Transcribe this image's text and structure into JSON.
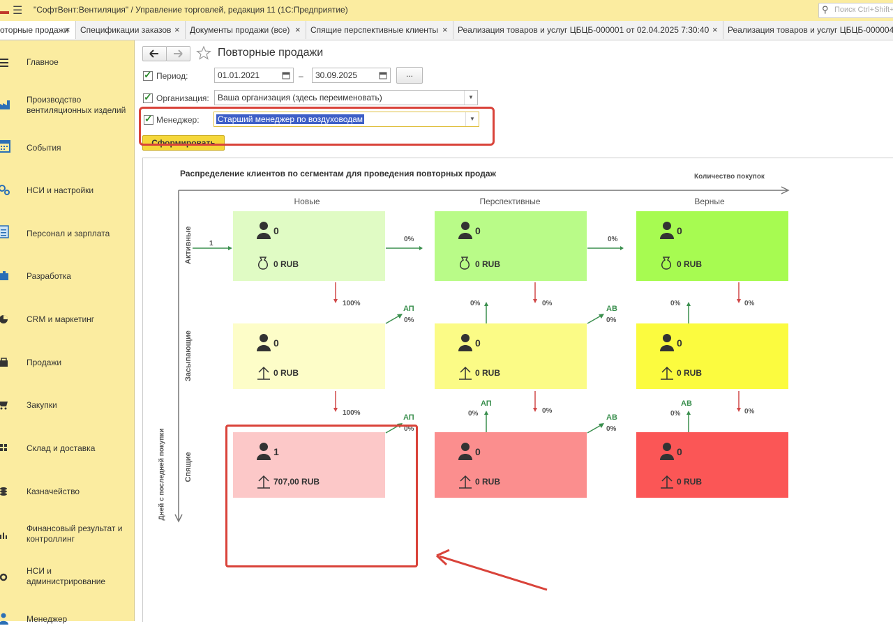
{
  "titlebar": {
    "title": "\"СофтВент:Вентиляция\" / Управление торговлей, редакция 11  (1С:Предприятие)",
    "search_placeholder": "Поиск Ctrl+Shift+F"
  },
  "tabs": [
    {
      "label": "оторные продажи"
    },
    {
      "label": "Спецификации заказов"
    },
    {
      "label": "Документы продажи (все)"
    },
    {
      "label": "Спящие перспективные клиенты"
    },
    {
      "label": "Реализация товаров и услуг ЦБЦБ-000001 от 02.04.2025 7:30:40"
    },
    {
      "label": "Реализация товаров и услуг ЦБЦБ-000004"
    }
  ],
  "sidebar": {
    "items": [
      {
        "label": "Главное",
        "icon": "menu-icon"
      },
      {
        "label": "Производство вентиляционных изделий",
        "icon": "factory-icon"
      },
      {
        "label": "События",
        "icon": "calendar-icon"
      },
      {
        "label": "НСИ и настройки",
        "icon": "gears-icon"
      },
      {
        "label": "Персонал и зарплата",
        "icon": "document-icon"
      },
      {
        "label": "Разработка",
        "icon": "puzzle-icon"
      },
      {
        "label": "CRM и маркетинг",
        "icon": "pie-icon"
      },
      {
        "label": "Продажи",
        "icon": "bag-icon"
      },
      {
        "label": "Закупки",
        "icon": "cart-icon"
      },
      {
        "label": "Склад и доставка",
        "icon": "grid-icon"
      },
      {
        "label": "Казначейство",
        "icon": "coins-icon"
      },
      {
        "label": "Финансовый результат и контроллинг",
        "icon": "bar-chart-icon"
      },
      {
        "label": "НСИ и администрирование",
        "icon": "gear-icon"
      },
      {
        "label": "Менеджер",
        "icon": "person-icon"
      }
    ]
  },
  "header": {
    "title": "Повторные продажи"
  },
  "form": {
    "period_label": "Период:",
    "period_from": "01.01.2021",
    "period_dash": "–",
    "period_to": "30.09.2025",
    "period_more": "...",
    "org_label": "Организация:",
    "org_value": "Ваша организация (здесь переименовать)",
    "manager_label": "Менеджер:",
    "manager_value": "Старший менеджер по воздуховодам",
    "generate_label": "Сформировать"
  },
  "report": {
    "title": "Распределение клиентов по сегментам для проведения повторных продаж",
    "x_axis_label": "Количество покупок",
    "y_axis_label": "Дней с последней покупки",
    "columns": [
      "Новые",
      "Перспективные",
      "Верные"
    ],
    "rows": [
      "Активные",
      "Засыпающие",
      "Спящие"
    ],
    "incoming": "1",
    "cells": [
      {
        "count": "0",
        "sum": "0 RUB",
        "color": "#e0fbc4"
      },
      {
        "count": "0",
        "sum": "0 RUB",
        "color": "#b9fb88"
      },
      {
        "count": "0",
        "sum": "0 RUB",
        "color": "#a7fb51"
      },
      {
        "count": "0",
        "sum": "0 RUB",
        "color": "#fdfdc8"
      },
      {
        "count": "0",
        "sum": "0 RUB",
        "color": "#fbfb86"
      },
      {
        "count": "0",
        "sum": "0 RUB",
        "color": "#fbfb3f"
      },
      {
        "count": "1",
        "sum": "707,00 RUB",
        "color": "#fcc8c8"
      },
      {
        "count": "0",
        "sum": "0 RUB",
        "color": "#fb8e8e"
      },
      {
        "count": "0",
        "sum": "0 RUB",
        "color": "#fb5656"
      }
    ],
    "pct": {
      "r1_h1": "0%",
      "r1_h2": "0%",
      "d_new_1": "100%",
      "d_new_2": "100%",
      "d_persp_1": "0%",
      "d_persp_2": "0%",
      "d_loyal_1": "0%",
      "d_loyal_2": "0%",
      "u_persp_1": "0%",
      "u_persp_2": "0%",
      "u_loyal_1": "0%",
      "u_loyal_2": "0%",
      "diag1": "0%",
      "diag2": "0%",
      "diag3": "0%",
      "diag4": "0%"
    },
    "labels": {
      "ap": "АП",
      "av": "АВ"
    }
  }
}
